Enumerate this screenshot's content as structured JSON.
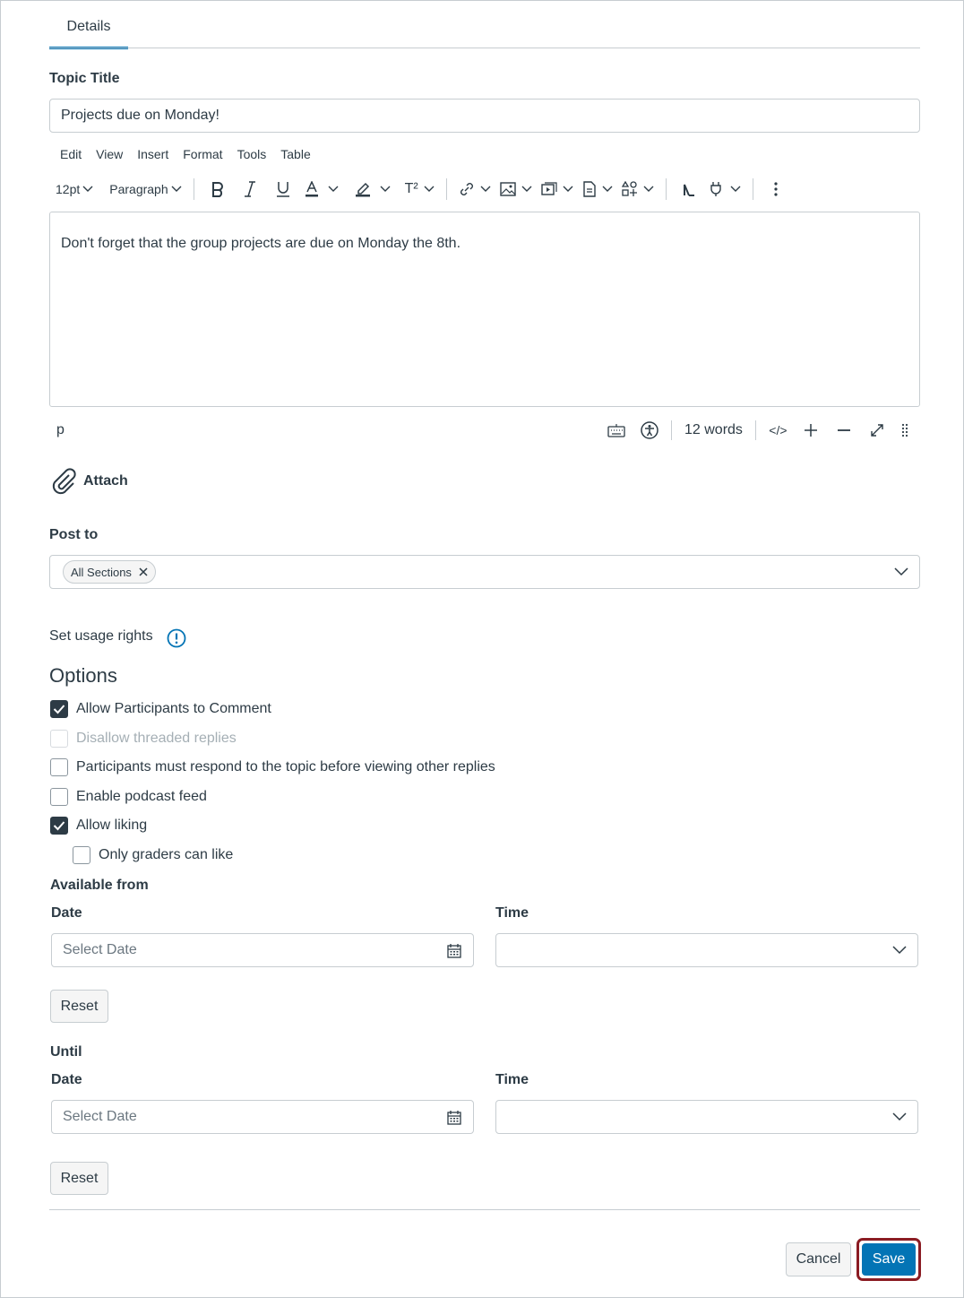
{
  "tabs": {
    "details": "Details"
  },
  "topic": {
    "label": "Topic Title",
    "value": "Projects due on Monday!"
  },
  "menubar": [
    "Edit",
    "View",
    "Insert",
    "Format",
    "Tools",
    "Table"
  ],
  "toolbar": {
    "font_size": "12pt",
    "block_format": "Paragraph",
    "superscript": "T²"
  },
  "editor": {
    "content": "Don't forget that the group projects are due on Monday the 8th.",
    "path": "p",
    "word_count": "12 words",
    "html_toggle": "</>"
  },
  "attach": {
    "label": "Attach"
  },
  "post_to": {
    "label": "Post to",
    "chip": "All Sections"
  },
  "usage_rights": {
    "label": "Set usage rights"
  },
  "options": {
    "heading": "Options",
    "items": [
      {
        "label": "Allow Participants to Comment",
        "checked": true,
        "disabled": false
      },
      {
        "label": "Disallow threaded replies",
        "checked": false,
        "disabled": true
      },
      {
        "label": "Participants must respond to the topic before viewing other replies",
        "checked": false,
        "disabled": false
      },
      {
        "label": "Enable podcast feed",
        "checked": false,
        "disabled": false
      },
      {
        "label": "Allow liking",
        "checked": true,
        "disabled": false
      },
      {
        "label": "Only graders can like",
        "checked": false,
        "disabled": false
      }
    ]
  },
  "available_from": {
    "heading": "Available from",
    "date_label": "Date",
    "date_placeholder": "Select Date",
    "time_label": "Time",
    "reset": "Reset"
  },
  "until": {
    "heading": "Until",
    "date_label": "Date",
    "date_placeholder": "Select Date",
    "time_label": "Time",
    "reset": "Reset"
  },
  "footer": {
    "cancel": "Cancel",
    "save": "Save"
  },
  "colors": {
    "accent": "#0374b5",
    "text": "#2d3b45",
    "border": "#c7cdd1",
    "focus_ring": "#8b1c23"
  }
}
